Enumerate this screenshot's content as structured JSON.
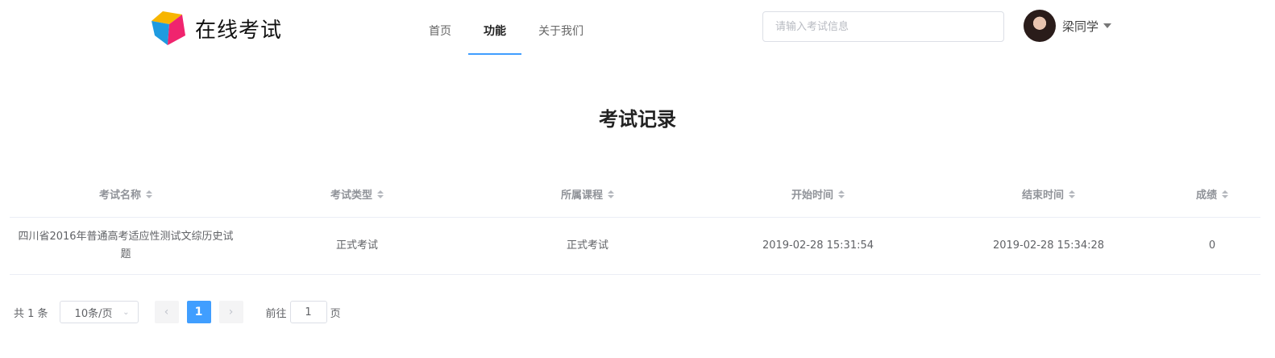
{
  "header": {
    "logo_text": "在线考试",
    "nav": [
      {
        "label": "首页",
        "active": false
      },
      {
        "label": "功能",
        "active": true
      },
      {
        "label": "关于我们",
        "active": false
      }
    ],
    "search_placeholder": "请输入考试信息",
    "user_name": "梁同学"
  },
  "page_title": "考试记录",
  "table": {
    "columns": [
      "考试名称",
      "考试类型",
      "所属课程",
      "开始时间",
      "结束时间",
      "成绩"
    ],
    "rows": [
      [
        "四川省2016年普通高考适应性测试文综历史试题",
        "正式考试",
        "正式考试",
        "2019-02-28 15:31:54",
        "2019-02-28 15:34:28",
        "0"
      ]
    ]
  },
  "pagination": {
    "total": "共 1 条",
    "page_size": "10条/页",
    "prev": "‹",
    "current_page": "1",
    "next": "›",
    "goto_prefix": "前往",
    "goto_value": "1",
    "goto_suffix": "页"
  },
  "colors": {
    "accent": "#409eff",
    "logo_yellow": "#f7b500",
    "logo_blue": "#1e9be0",
    "logo_pink": "#f0246e"
  }
}
